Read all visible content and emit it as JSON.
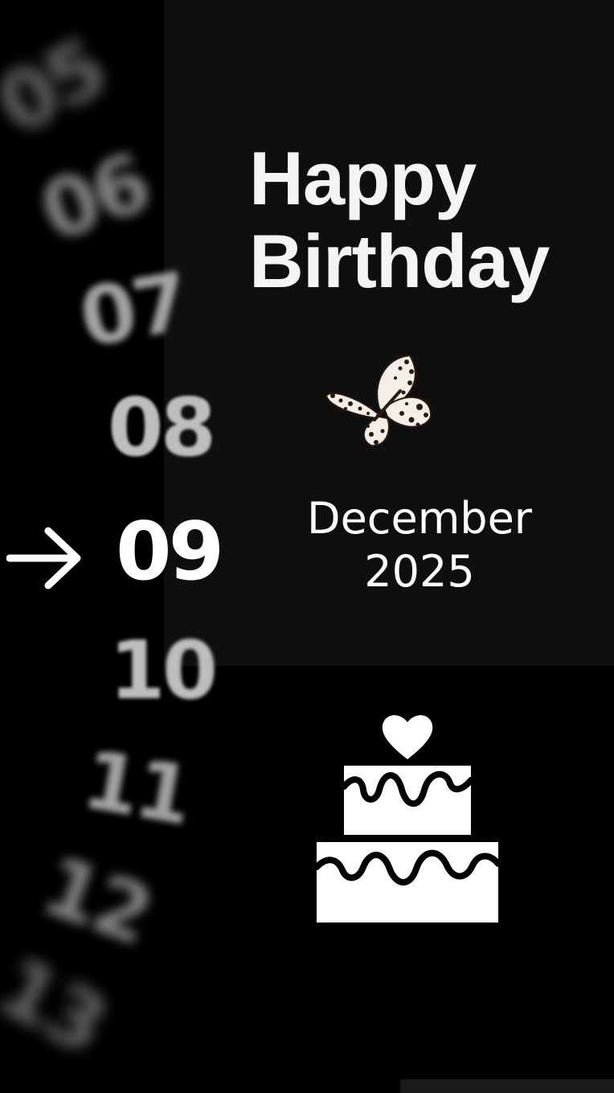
{
  "greeting": {
    "line1": "Happy",
    "line2": "Birthday"
  },
  "date": {
    "month": "December",
    "year": "2025"
  },
  "day_picker": {
    "days": [
      "05",
      "06",
      "07",
      "08",
      "09",
      "10",
      "11",
      "12",
      "13"
    ],
    "selected": "09",
    "arrow_icon": "arrow-right-icon"
  },
  "decorations": {
    "butterfly_icon": "butterfly-icon",
    "cake_icon": "cake-icon"
  },
  "colors": {
    "background": "#000000",
    "panel": "#0f0f0f",
    "text": "#ffffff",
    "faded_number": "#bdbdbd"
  }
}
